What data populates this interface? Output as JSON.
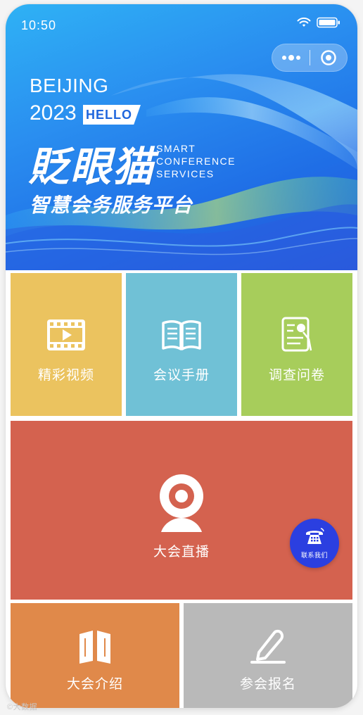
{
  "status_bar": {
    "time": "10:50",
    "icons": [
      "wifi-icon",
      "battery-icon"
    ]
  },
  "capsule": {
    "icons": [
      "more-dots-icon",
      "target-circle-icon"
    ]
  },
  "banner": {
    "city": "BEIJING",
    "year": "2023",
    "hello": "HELLO",
    "brand": "貶眼猫",
    "smart_lines": [
      "SMART",
      "CONFERENCE",
      "SERVICES"
    ],
    "platform": "智慧会务服务平台"
  },
  "tiles": {
    "video": {
      "label": "精彩视频",
      "icon": "film-play-icon",
      "color": "#ebc35f"
    },
    "manual": {
      "label": "会议手册",
      "icon": "open-book-icon",
      "color": "#70c1d6"
    },
    "survey": {
      "label": "调查问卷",
      "icon": "questionnaire-icon",
      "color": "#a7cd5b"
    },
    "live": {
      "label": "大会直播",
      "icon": "webcam-icon",
      "color": "#d4624f"
    },
    "intro": {
      "label": "大会介绍",
      "icon": "open-book-icon",
      "color": "#e0894a"
    },
    "signup": {
      "label": "参会报名",
      "icon": "pen-sign-icon",
      "color": "#b9b9b9"
    }
  },
  "contact": {
    "label": "联系我们",
    "icon": "telephone-icon",
    "color": "#2b3fe0"
  },
  "watermark": "©大数据"
}
